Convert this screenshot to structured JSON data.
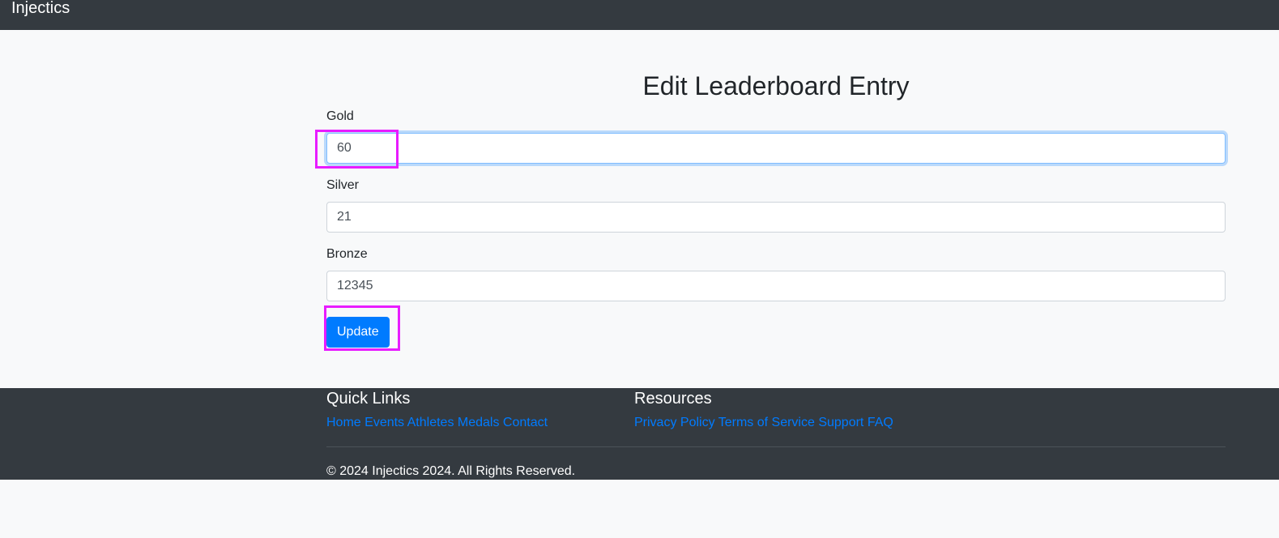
{
  "navbar": {
    "brand": "Injectics"
  },
  "form": {
    "title": "Edit Leaderboard Entry",
    "gold": {
      "label": "Gold",
      "value": "60"
    },
    "silver": {
      "label": "Silver",
      "value": "21"
    },
    "bronze": {
      "label": "Bronze",
      "value": "12345"
    },
    "submit_label": "Update"
  },
  "footer": {
    "quick_links": {
      "heading": "Quick Links",
      "links": [
        "Home",
        "Events",
        "Athletes",
        "Medals",
        "Contact"
      ]
    },
    "resources": {
      "heading": "Resources",
      "links": [
        "Privacy Policy",
        "Terms of Service",
        "Support",
        "FAQ"
      ]
    },
    "copyright": "© 2024 Injectics 2024. All Rights Reserved."
  },
  "colors": {
    "navbar_bg": "#343a40",
    "page_bg": "#f8f9fa",
    "primary": "#007bff",
    "highlight": "#e81cff"
  }
}
